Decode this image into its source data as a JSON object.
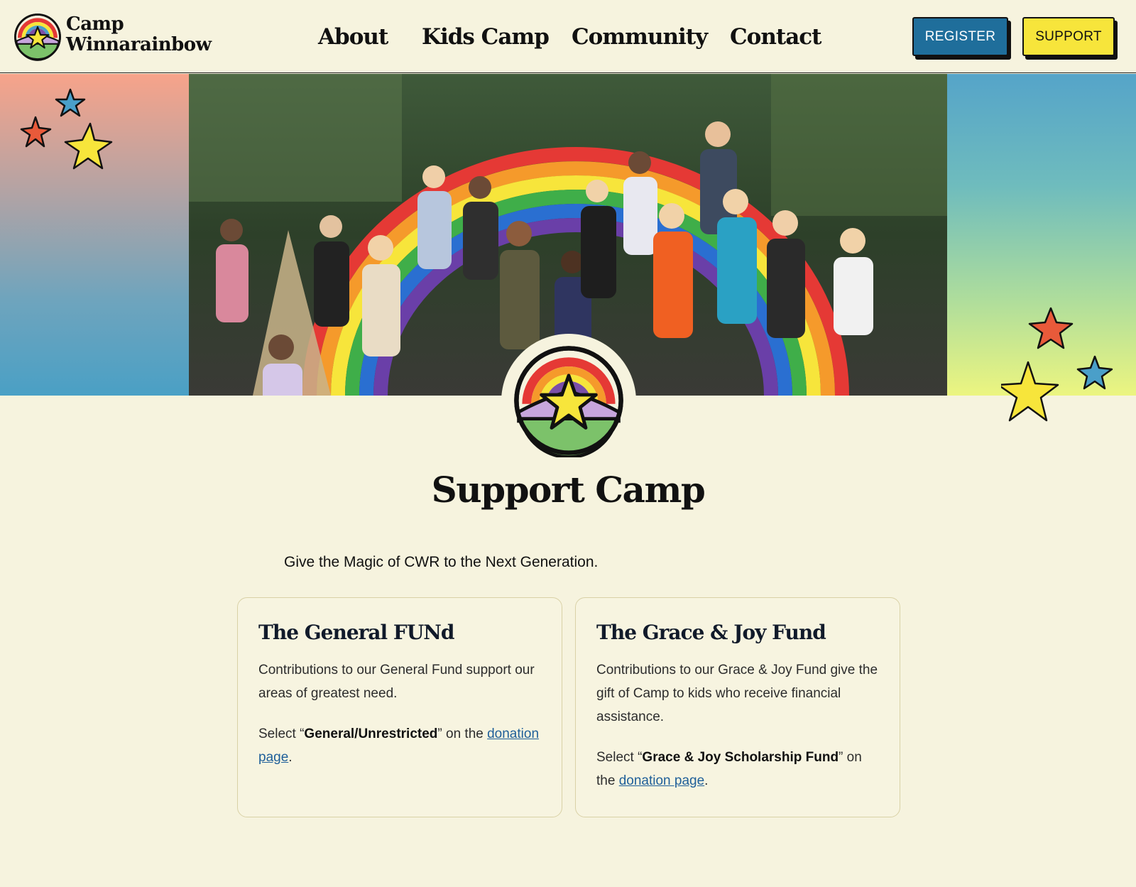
{
  "header": {
    "brand_line1": "Camp",
    "brand_line2": "Winnarainbow",
    "nav": [
      {
        "label": "About"
      },
      {
        "label": "Kids Camp"
      },
      {
        "label": "Community"
      },
      {
        "label": "Contact"
      }
    ],
    "register_label": "REGISTER",
    "support_label": "SUPPORT"
  },
  "colors": {
    "background": "#f6f3de",
    "register_button": "#1f6e9b",
    "support_button": "#f7e53b",
    "link": "#1f5f99",
    "star_yellow": "#f7e53b",
    "star_red": "#e85a3a",
    "star_blue": "#4a9fc9"
  },
  "hero": {
    "image_desc": "group-photo-rainbow-arch"
  },
  "main": {
    "title": "Support Camp",
    "tagline": "Give the Magic of CWR to the Next Generation."
  },
  "cards": [
    {
      "title": "The General FUNd",
      "body": "Contributions to our General Fund support our areas of greatest need.",
      "select_prefix": "Select “",
      "select_bold": "General/Unrestricted",
      "select_mid": "” on the ",
      "link_text": "donation page",
      "select_suffix": "."
    },
    {
      "title": "The Grace & Joy Fund",
      "body": "Contributions to our Grace & Joy Fund give the gift of Camp to kids who receive financial assistance.",
      "select_prefix": "Select “",
      "select_bold": "Grace & Joy Scholarship Fund",
      "select_mid": "” on the ",
      "link_text": "donation page",
      "select_suffix": "."
    }
  ]
}
